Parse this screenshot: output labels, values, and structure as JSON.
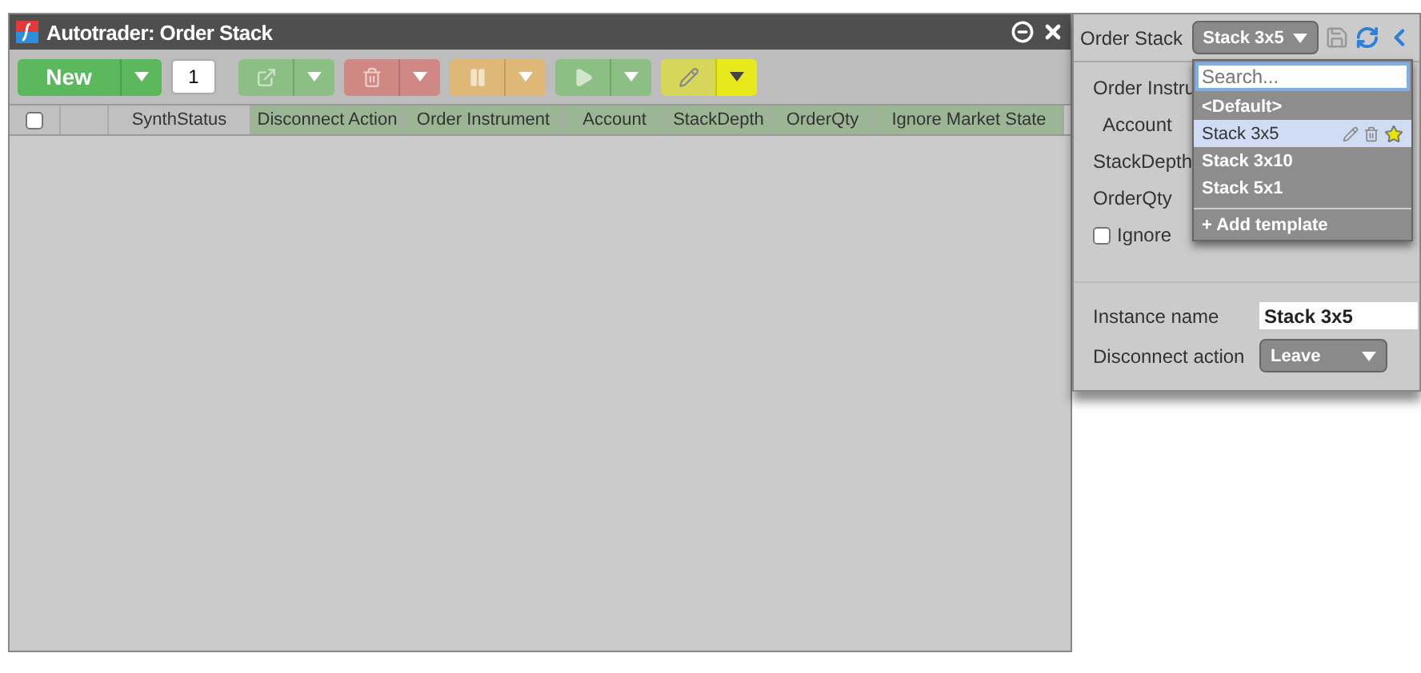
{
  "window": {
    "title": "Autotrader: Order Stack"
  },
  "toolbar": {
    "new_label": "New",
    "quantity": "1",
    "groups": [
      {
        "kind": "export",
        "color": "#8cbf84",
        "disabled": true
      },
      {
        "kind": "delete",
        "color": "#d08884",
        "disabled": true
      },
      {
        "kind": "pause",
        "color": "#dfb877",
        "disabled": true
      },
      {
        "kind": "play",
        "color": "#8cbf84",
        "disabled": true
      },
      {
        "kind": "edit",
        "color": "#d6d65a",
        "disabled": false
      }
    ]
  },
  "table": {
    "select_all_checked": false,
    "columns": [
      {
        "highlighted": false
      },
      {
        "label": "SynthStatus",
        "highlighted": false
      },
      {
        "label": "Disconnect Action",
        "highlighted": true
      },
      {
        "label": "Order Instrument",
        "highlighted": true
      },
      {
        "label": "Account",
        "highlighted": true
      },
      {
        "label": "StackDepth",
        "highlighted": true
      },
      {
        "label": "OrderQty",
        "highlighted": true
      },
      {
        "label": "Ignore Market State",
        "highlighted": true
      }
    ]
  },
  "panel": {
    "template_label": "Order Stack",
    "template_value": "Stack 3x5",
    "fields": [
      {
        "label": "Order Instru",
        "indent": false
      },
      {
        "label": "Account",
        "indent": true
      },
      {
        "label": "StackDepth",
        "indent": false
      },
      {
        "label": "OrderQty",
        "indent": false
      }
    ],
    "ignore_market_state": {
      "label": "Ignore",
      "checked": false
    },
    "instance_name": {
      "label": "Instance name",
      "value": "Stack 3x5"
    },
    "disconnect_action": {
      "label": "Disconnect action",
      "value": "Leave"
    }
  },
  "template_menu": {
    "placeholder": "Search...",
    "items": [
      {
        "label": "<Default>",
        "selected": false,
        "starred": false
      },
      {
        "label": "Stack 3x5",
        "selected": true,
        "starred": true
      },
      {
        "label": "Stack 3x10",
        "selected": false,
        "starred": false
      },
      {
        "label": "Stack 5x1",
        "selected": false,
        "starred": false
      }
    ],
    "add_label": "+ Add template"
  }
}
